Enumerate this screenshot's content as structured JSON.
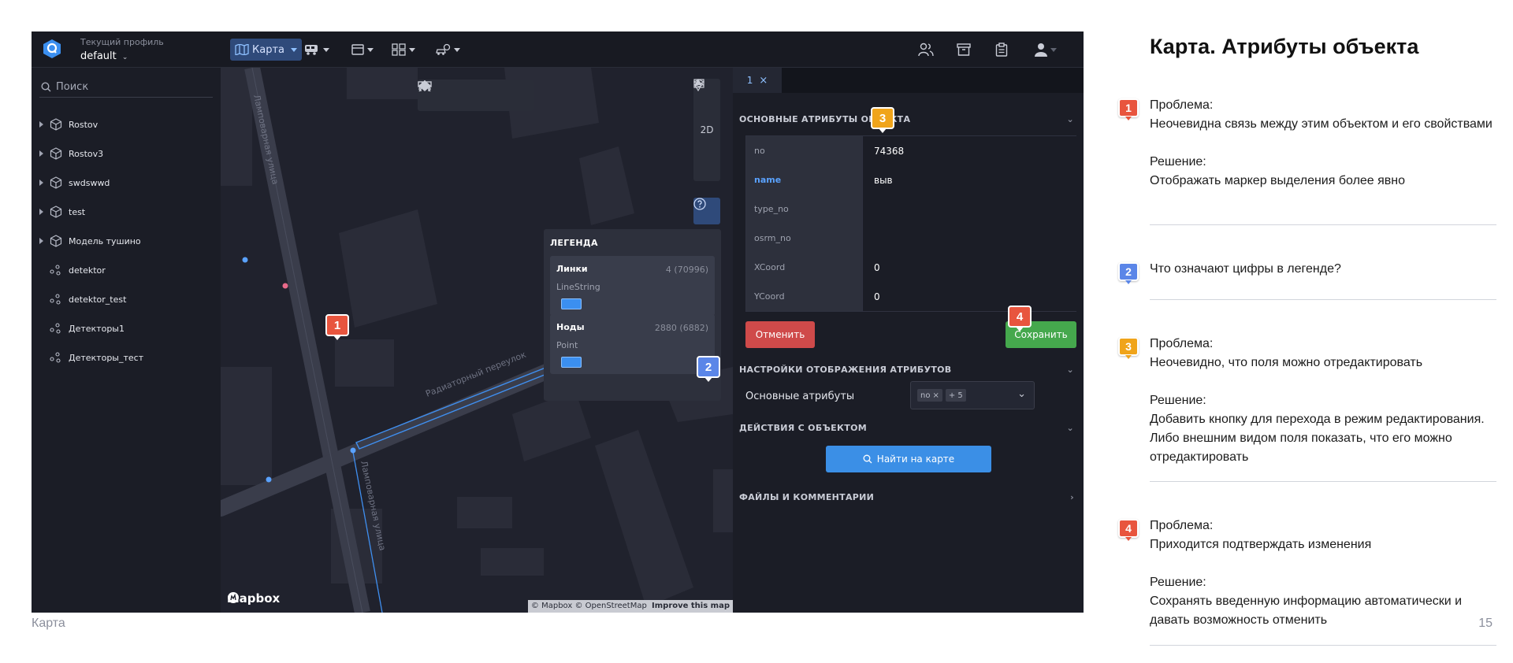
{
  "slide": {
    "title": "Карта. Атрибуты объекта",
    "footer_left": "Карта",
    "page_number": "15"
  },
  "topbar": {
    "profile_label": "Текущий профиль",
    "profile_value": "default",
    "map_menu": "Карта"
  },
  "sidebar": {
    "search_placeholder": "Поиск",
    "items": [
      {
        "label": "Rostov",
        "icon": "cube-icon"
      },
      {
        "label": "Rostov3",
        "icon": "cube-icon"
      },
      {
        "label": "swdswwd",
        "icon": "cube-icon"
      },
      {
        "label": "test",
        "icon": "cube-icon"
      },
      {
        "label": "Модель тушино",
        "icon": "cube-icon"
      },
      {
        "label": "detektor",
        "icon": "points-icon"
      },
      {
        "label": "detektor_test",
        "icon": "points-icon"
      },
      {
        "label": "Детекторы1",
        "icon": "points-icon"
      },
      {
        "label": "Детекторы_тест",
        "icon": "points-icon"
      }
    ]
  },
  "map": {
    "view_mode": "2D",
    "street_1": "Ламповарная улица",
    "street_2": "Радиаторный переулок",
    "street_3": "Ламповарная улица",
    "mapbox": "mapbox",
    "attribution_1": "© Mapbox © OpenStreetMap",
    "attribution_2": "Improve this map",
    "legend": {
      "title": "ЛЕГЕНДА",
      "items": [
        {
          "name": "Линки",
          "count": "4 (70996)",
          "type": "LineString"
        },
        {
          "name": "Ноды",
          "count": "2880 (6882)",
          "type": "Point"
        }
      ]
    }
  },
  "panel": {
    "tab_label": "1",
    "section_main": "ОСНОВНЫЕ АТРИБУТЫ ОБЪЕКТА",
    "attributes": [
      {
        "key": "no",
        "value": "74368"
      },
      {
        "key": "name",
        "value": "выв"
      },
      {
        "key": "type_no",
        "value": ""
      },
      {
        "key": "osrm_no",
        "value": ""
      },
      {
        "key": "XCoord",
        "value": "0"
      },
      {
        "key": "YCoord",
        "value": "0"
      }
    ],
    "cancel_label": "Отменить",
    "save_label": "Сохранить",
    "section_display": "НАСТРОЙКИ ОТОБРАЖЕНИЯ АТРИБУТОВ",
    "display_row_label": "Основные атрибуты",
    "chip_1": "no",
    "chip_2": "+ 5",
    "section_actions": "ДЕЙСТВИЯ С ОБЪЕКТОМ",
    "find_label": "Найти на карте",
    "section_files": "ФАЙЛЫ И КОММЕНТАРИИ"
  },
  "markers": {
    "m1": "1",
    "m2": "2",
    "m3": "3",
    "m4": "4"
  },
  "notes": [
    {
      "marker": "1",
      "color": "#e8553e",
      "problem_label": "Проблема:",
      "problem": "Неочевидна связь между этим объектом и его свойствами",
      "solution_label": "Решение:",
      "solution": "Отображать маркер выделения более явно"
    },
    {
      "marker": "2",
      "color": "#5b86e8",
      "question": "Что означают цифры в легенде?"
    },
    {
      "marker": "3",
      "color": "#f0a41a",
      "problem_label": "Проблема:",
      "problem": "Неочевидно, что поля можно отредактировать",
      "solution_label": "Решение:",
      "solution": "Добавить кнопку для перехода в режим редактирования. Либо внешним видом поля показать, что его можно отредактировать"
    },
    {
      "marker": "4",
      "color": "#e8553e",
      "problem_label": "Проблема:",
      "problem": "Приходится подтверждать изменения",
      "solution_label": "Решение:",
      "solution": "Сохранять введенную информацию автоматически и давать возможность отменить"
    }
  ]
}
